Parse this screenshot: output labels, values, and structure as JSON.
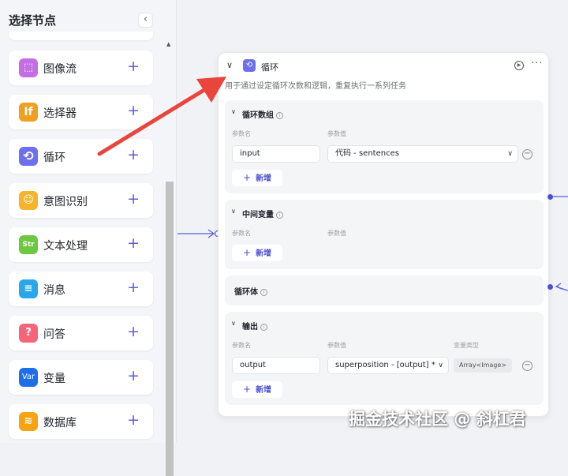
{
  "sidebar": {
    "title": "选择节点",
    "collapse_glyph": "‹",
    "items": [
      {
        "label": "图像流",
        "icon": "image-flow-icon",
        "color": "#c46ee3",
        "glyph": "⬚"
      },
      {
        "label": "选择器",
        "icon": "if-selector-icon",
        "color": "#f0a020",
        "glyph": "If"
      },
      {
        "label": "循环",
        "icon": "loop-icon",
        "color": "#6d6fec",
        "glyph": "⟲"
      },
      {
        "label": "意图识别",
        "icon": "intent-icon",
        "color": "#f5b42a",
        "glyph": "☺"
      },
      {
        "label": "文本处理",
        "icon": "text-process-icon",
        "color": "#6cc83e",
        "glyph": "Str"
      },
      {
        "label": "消息",
        "icon": "message-icon",
        "color": "#2aa7ea",
        "glyph": "≡"
      },
      {
        "label": "问答",
        "icon": "qa-icon",
        "color": "#f5657a",
        "glyph": "?"
      },
      {
        "label": "变量",
        "icon": "variable-icon",
        "color": "#1e6ee8",
        "glyph": "Var"
      },
      {
        "label": "数据库",
        "icon": "database-icon",
        "color": "#f5a414",
        "glyph": "≋"
      }
    ],
    "add_glyph": "+"
  },
  "node": {
    "title": "循环",
    "description": "用于通过设定循环次数和逻辑，重复执行一系列任务",
    "more_glyph": "···",
    "loop_array": {
      "title": "循环数组",
      "param_name_label": "参数名",
      "param_value_label": "参数值",
      "name": "input",
      "value": "代码 - sentences",
      "add_label": "新增"
    },
    "intermediate": {
      "title": "中间变量",
      "param_name_label": "参数名",
      "param_value_label": "参数值",
      "add_label": "新增"
    },
    "loop_body": {
      "title": "循环体"
    },
    "output": {
      "title": "输出",
      "param_name_label": "参数名",
      "param_value_label": "参数值",
      "var_type_label": "变量类型",
      "name": "output",
      "value": "superposition - [output] *",
      "type": "Array<Image>",
      "add_label": "新增"
    }
  },
  "watermark": "掘金技术社区 @ 斜杠君",
  "colors": {
    "accent": "#4b4fd4",
    "arrow": "#e8453c"
  }
}
